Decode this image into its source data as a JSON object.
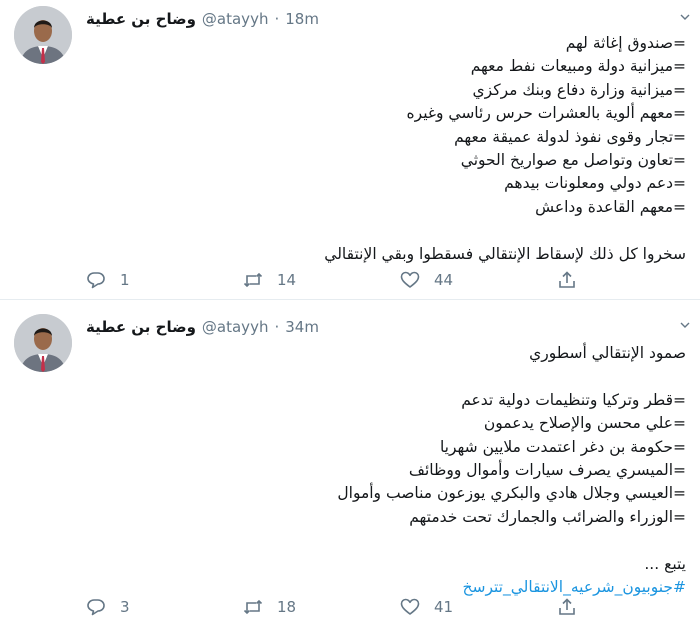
{
  "colors": {
    "text": "#14171a",
    "secondary": "#657786",
    "link": "#1b95e0",
    "divider": "#e6ecf0"
  },
  "tweets": [
    {
      "author_name": "وضاح بن عطية",
      "handle": "@atayyh",
      "separator": "·",
      "time": "18m",
      "avatar_icon": "user-avatar-photo",
      "lines": [
        "=صندوق إغاثة لهم",
        "=ميزانية دولة ومبيعات نفط معهم",
        "=ميزانية وزارة دفاع وبنك مركزي",
        "=معهم ألوية بالعشرات حرس رئاسي وغيره",
        "=تجار وقوى نفوذ لدولة عميقة معهم",
        "=تعاون وتواصل مع صواريخ الحوثي",
        "=دعم دولي ومعلونات بيدهم",
        "=معهم القاعدة وداعش",
        "",
        "سخروا كل ذلك لإسقاط الإنتقالي فسقطوا وبقي الإنتقالي"
      ],
      "hashtag": "",
      "replies": "1",
      "retweets": "14",
      "likes": "44"
    },
    {
      "author_name": "وضاح بن عطية",
      "handle": "@atayyh",
      "separator": "·",
      "time": "34m",
      "avatar_icon": "user-avatar-photo",
      "lines": [
        "صمود الإنتقالي أسطوري",
        "",
        "=قطر وتركيا وتنظيمات دولية تدعم",
        "=علي محسن والإصلاح يدعمون",
        "=حكومة بن دغر اعتمدت ملايين شهريا",
        "=الميسري يصرف سيارات وأموال ووظائف",
        "=العيسي وجلال هادي والبكري يوزعون مناصب وأموال",
        "=الوزراء والضرائب والجمارك تحت خدمتهم",
        "",
        "يتبع ..."
      ],
      "hashtag": "#جنوبيون_شرعيه_الانتقالي_تترسخ",
      "replies": "3",
      "retweets": "18",
      "likes": "41"
    }
  ]
}
